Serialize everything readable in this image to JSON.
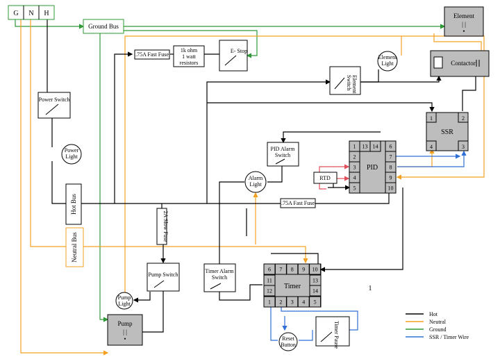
{
  "colors": {
    "hot": "#000000",
    "neutral": "#f5a021",
    "ground": "#2e9a36",
    "ssr_timer": "#2f6fd6",
    "rtd": "#e0505a",
    "component_gray": "#bdbdbd"
  },
  "terminals": {
    "g": "G",
    "n": "N",
    "h": "H"
  },
  "labels": {
    "ground_bus": "Ground Bus",
    "element": "Element",
    "element_symbol": "| |",
    "element_dot": "•",
    "fuse_top": ".75A Fast Fuse",
    "resistor_l1": "1k ohm",
    "resistor_l2": "1 watt",
    "resistor_l3": "resistors",
    "estop": "E-  Stop",
    "element_light_l1": "Element",
    "element_light_l2": "Light",
    "contactor": "Contactor",
    "element_switch_l1": "Element",
    "element_switch_l2": "Switch",
    "power_switch": "Power Switch",
    "power_light_l1": "Power",
    "power_light_l2": "Light",
    "ssr": "SSR",
    "pid_alarm_l1": "PID Alarm",
    "pid_alarm_l2": "Switch",
    "pid": "PID",
    "rtd": "RTD",
    "alarm_light_l1": "Alarm",
    "alarm_light_l2": "Light",
    "hot_bus": "Hot Bus",
    "fuse_mid": ".75A Fast Fuse",
    "fuse_slow": "2A Slow Fuse",
    "neutral_bus": "Neutral Bus",
    "pump_switch": "Pump Switch",
    "timer_alarm_l1": "Timer Alarm",
    "timer_alarm_l2": "Switch",
    "timer": "Timer",
    "pump_light_l1": "Pump",
    "pump_light_l2": "Light",
    "pump": "Pump",
    "pump_symbol": "| |",
    "pump_dot": "•",
    "reset_l1": "Reset",
    "reset_l2": "Button",
    "timer_pause": "Timer Pause",
    "page_mark": "1"
  },
  "ssr_pins": [
    "1",
    "2",
    "4",
    "3"
  ],
  "pid_pins": [
    "1",
    "13",
    "14",
    "6",
    "2",
    "7",
    "3",
    "8",
    "4",
    "9",
    "5",
    "10"
  ],
  "timer_pins": [
    "6",
    "7",
    "8",
    "9",
    "10",
    "11",
    "13",
    "12",
    "14",
    "1",
    "2",
    "3",
    "4",
    "5"
  ],
  "legend": [
    {
      "label": "Hot",
      "color": "#000000"
    },
    {
      "label": "Neutral",
      "color": "#f5a021"
    },
    {
      "label": "Ground",
      "color": "#2e9a36"
    },
    {
      "label": "SSR / Timer Wire",
      "color": "#2f6fd6"
    }
  ]
}
